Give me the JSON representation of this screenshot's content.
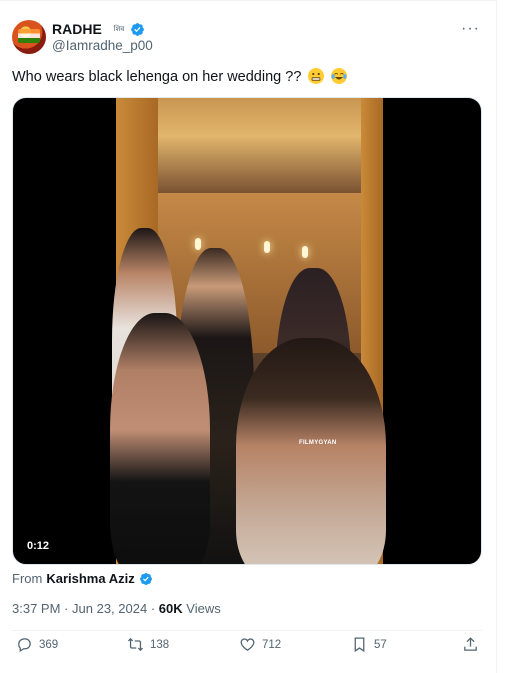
{
  "user": {
    "display_name": "RADHE",
    "handle": "@Iamradhe_p00",
    "mini_label": "शिव"
  },
  "tweet": {
    "text": "Who wears black lehenga on her wedding ??",
    "emojis": [
      "grimacing-face",
      "face-with-tears-of-joy"
    ]
  },
  "media": {
    "duration": "0:12",
    "watermark": "FILMYGYAN"
  },
  "attribution": {
    "prefix": "From",
    "name": "Karishma Aziz"
  },
  "meta": {
    "time": "3:37 PM",
    "separator1": "·",
    "date": "Jun 23, 2024",
    "separator2": "·",
    "views_count": "60K",
    "views_label": "Views"
  },
  "actions": {
    "replies": "369",
    "reposts": "138",
    "likes": "712",
    "bookmarks": "57"
  },
  "colors": {
    "verified_blue": "#1d9bf0",
    "secondary_text": "#536471",
    "primary_text": "#0f1419"
  }
}
